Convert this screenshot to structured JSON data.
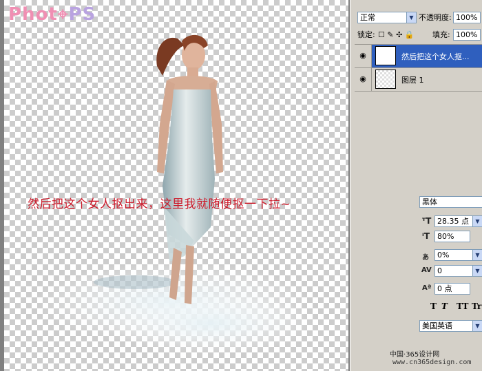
{
  "logo": {
    "part1": "Phot",
    "part2": "PS"
  },
  "canvas": {
    "overlay_text": "然后把这个女人抠出来，这里我就随便抠一下拉~"
  },
  "layers_panel": {
    "blend_mode": "正常",
    "opacity_label": "不透明度:",
    "opacity_value": "100%",
    "lock_label": "锁定:",
    "fill_label": "填充:",
    "fill_value": "100%",
    "layers": [
      {
        "name": "然后把这个女人抠...",
        "type": "text",
        "thumb": "T",
        "active": true
      },
      {
        "name": "图层 1",
        "type": "image",
        "active": false
      }
    ]
  },
  "character_panel": {
    "font_family": "黑体",
    "font_size": "28.35 点",
    "leading": "80%",
    "kerning": "0%",
    "tracking": "0",
    "baseline_shift": "0 点",
    "style_buttons": [
      "T",
      "T",
      "TT",
      "Tr"
    ],
    "language": "美国英语"
  },
  "watermark": {
    "line1": "中国·365设计网",
    "line2": "www.cn365design.com"
  }
}
